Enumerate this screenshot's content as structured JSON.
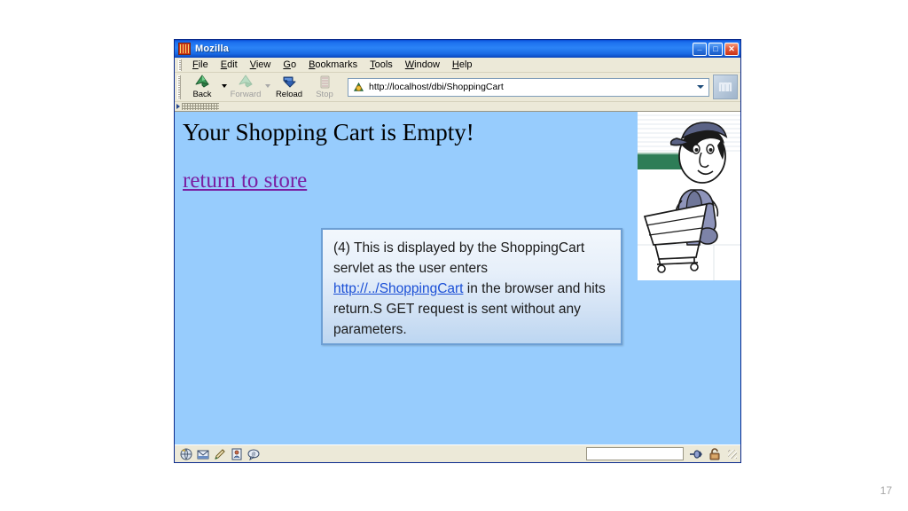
{
  "slide": {
    "number": "17",
    "background_color": "#ffffff"
  },
  "browser": {
    "title": "Mozilla",
    "title_icon": "mozilla-icon",
    "window_controls": [
      {
        "name": "minimize",
        "glyph": "_"
      },
      {
        "name": "maximize",
        "glyph": "□"
      },
      {
        "name": "close",
        "glyph": "✕"
      }
    ],
    "menu": [
      {
        "label": "File",
        "accel": "F"
      },
      {
        "label": "Edit",
        "accel": "E"
      },
      {
        "label": "View",
        "accel": "V"
      },
      {
        "label": "Go",
        "accel": "G"
      },
      {
        "label": "Bookmarks",
        "accel": "B"
      },
      {
        "label": "Tools",
        "accel": "T"
      },
      {
        "label": "Window",
        "accel": "W"
      },
      {
        "label": "Help",
        "accel": "H"
      }
    ],
    "toolbar": {
      "back_label": "Back",
      "forward_label": "Forward",
      "reload_label": "Reload",
      "stop_label": "Stop",
      "back_enabled": true,
      "forward_enabled": false,
      "reload_enabled": true,
      "stop_enabled": false,
      "throbber_icon": "mozilla-logo-icon"
    },
    "address_bar": {
      "url": "http://localhost/dbi/ShoppingCart",
      "placeholder": "Enter address",
      "favicon": "page-favicon",
      "dropdown_icon": "chevron-down-icon"
    },
    "personal_toolbar": {
      "collapsed": true
    },
    "status_bar": {
      "progress_text": "",
      "left_icons": [
        "browser-icon",
        "mail-icon",
        "composer-icon",
        "addressbook-icon",
        "irc-chat-icon"
      ],
      "right_icons": [
        "network-proxy-icon",
        "security-padlock-icon"
      ]
    },
    "page": {
      "heading": "Your Shopping Cart is Empty!",
      "link_text": "return to store",
      "background_color": "#97ccfd",
      "heading_color": "#000000",
      "link_color": "#7a1fa2",
      "figure": "shopper-with-cart-cartoon"
    }
  },
  "callout": {
    "text_before": "(4) This is displayed by the ShoppingCart servlet as the user enters ",
    "link_text": "http://../ShoppingCart",
    "text_after": " in the browser and hits return.S GET request is sent without any parameters.",
    "border_color": "#6d9fd4",
    "link_color": "#1a4fd6"
  }
}
